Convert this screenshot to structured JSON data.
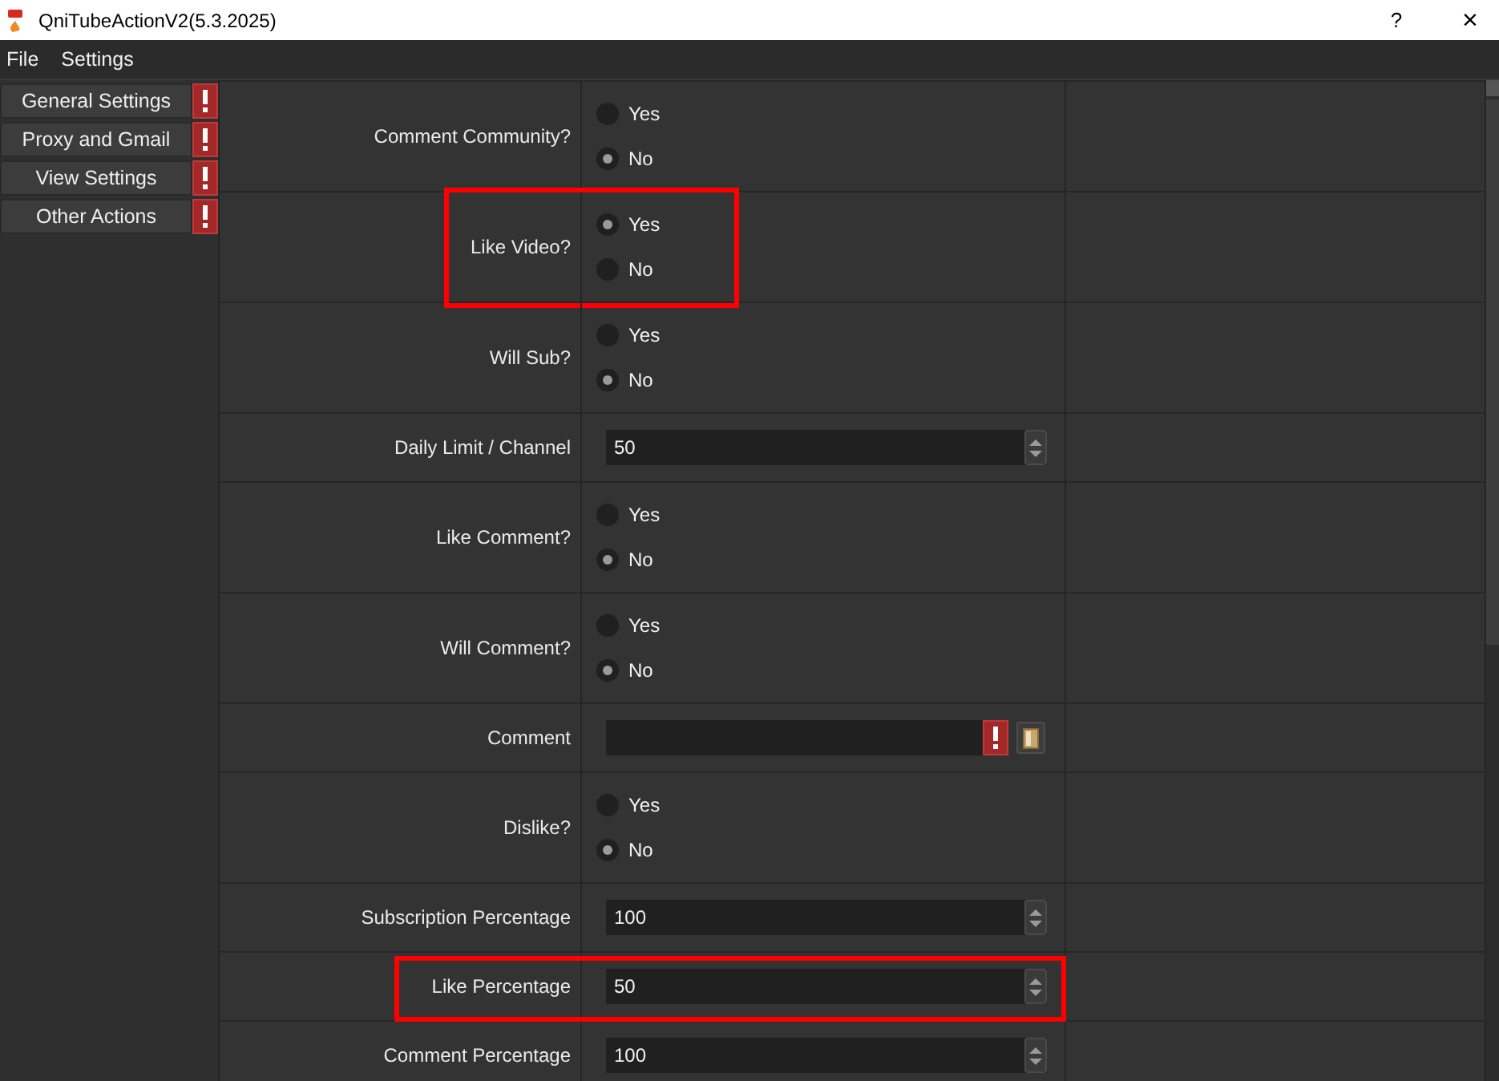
{
  "window": {
    "title": "QniTubeActionV2(5.3.2025)",
    "help": "?",
    "close": "×"
  },
  "menu": [
    "File",
    "Settings"
  ],
  "sidebar": {
    "items": [
      {
        "label": "General Settings",
        "warning": true
      },
      {
        "label": "Proxy and Gmail",
        "warning": true
      },
      {
        "label": "View Settings",
        "warning": true
      },
      {
        "label": "Other Actions",
        "warning": true
      }
    ]
  },
  "rows": [
    {
      "kind": "radio",
      "label": "Comment Community?",
      "highlighted": false,
      "options": [
        {
          "label": "Yes",
          "selected": false
        },
        {
          "label": "No",
          "selected": true
        }
      ]
    },
    {
      "kind": "radio",
      "label": "Like Video?",
      "highlighted": true,
      "options": [
        {
          "label": "Yes",
          "selected": true
        },
        {
          "label": "No",
          "selected": false
        }
      ]
    },
    {
      "kind": "radio",
      "label": "Will Sub?",
      "highlighted": false,
      "options": [
        {
          "label": "Yes",
          "selected": false
        },
        {
          "label": "No",
          "selected": true
        }
      ]
    },
    {
      "kind": "spin",
      "label": "Daily Limit / Channel",
      "highlighted": false,
      "value": "50"
    },
    {
      "kind": "radio",
      "label": "Like Comment?",
      "highlighted": false,
      "options": [
        {
          "label": "Yes",
          "selected": false
        },
        {
          "label": "No",
          "selected": true
        }
      ]
    },
    {
      "kind": "radio",
      "label": "Will Comment?",
      "highlighted": false,
      "options": [
        {
          "label": "Yes",
          "selected": false
        },
        {
          "label": "No",
          "selected": true
        }
      ]
    },
    {
      "kind": "text",
      "label": "Comment",
      "highlighted": false,
      "warning": true
    },
    {
      "kind": "radio",
      "label": "Dislike?",
      "highlighted": false,
      "options": [
        {
          "label": "Yes",
          "selected": false
        },
        {
          "label": "No",
          "selected": true
        }
      ]
    },
    {
      "kind": "spin",
      "label": "Subscription Percentage",
      "highlighted": false,
      "value": "100"
    },
    {
      "kind": "spin",
      "label": "Like Percentage",
      "highlighted": true,
      "value": "50"
    },
    {
      "kind": "spin",
      "label": "Comment Percentage",
      "highlighted": false,
      "value": "100"
    }
  ]
}
